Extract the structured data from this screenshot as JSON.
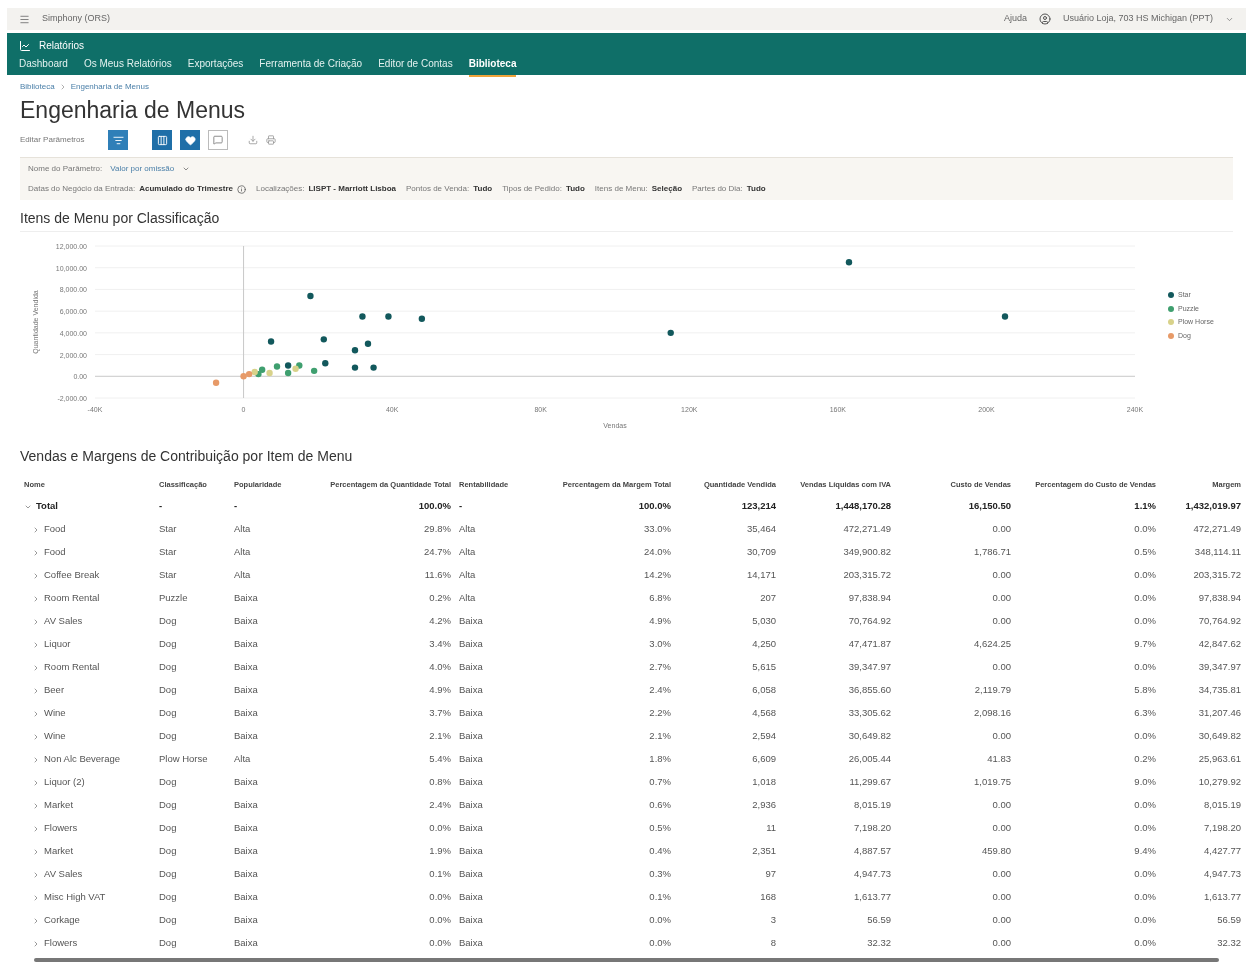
{
  "top_bar": {
    "app_name": "Simphony (ORS)",
    "help": "Ajuda",
    "user": "Usuário Loja, 703 HS Michigan (PPT)"
  },
  "header": {
    "title": "Relatórios",
    "tabs": [
      {
        "label": "Dashboard",
        "selected": false
      },
      {
        "label": "Os Meus Relatórios",
        "selected": false
      },
      {
        "label": "Exportações",
        "selected": false
      },
      {
        "label": "Ferramenta de Criação",
        "selected": false
      },
      {
        "label": "Editor de Contas",
        "selected": false
      },
      {
        "label": "Biblioteca",
        "selected": true
      }
    ]
  },
  "breadcrumb": [
    "Biblioteca",
    "Engenharia de Menus"
  ],
  "page_title": "Engenharia de Menus",
  "toolbar": {
    "label": "Editar Parâmetros"
  },
  "parameters": {
    "label": "Nome do Parâmetro:",
    "value": "Valor por omissão"
  },
  "filters": [
    {
      "label": "Datas do Negócio da Entrada:",
      "value": "Acumulado do Trimestre",
      "info": true
    },
    {
      "label": "Localizações:",
      "value": "LISPT - Marriott Lisboa"
    },
    {
      "label": "Pontos de Venda:",
      "value": "Tudo"
    },
    {
      "label": "Tipos de Pedido:",
      "value": "Tudo"
    },
    {
      "label": "Itens de Menu:",
      "value": "Seleção"
    },
    {
      "label": "Partes do Dia:",
      "value": "Tudo"
    }
  ],
  "chart_section": {
    "title": "Itens de Menu por Classificação",
    "chart_data": {
      "type": "scatter",
      "grid": true,
      "xlabel": "Vendas",
      "ylabel": "Quantidade Vendida",
      "xlim": [
        -40000,
        240000
      ],
      "ylim": [
        -2000,
        12000
      ],
      "xticks": [
        {
          "value": -40000,
          "label": "-40K"
        },
        {
          "value": 0,
          "label": "0"
        },
        {
          "value": 40000,
          "label": "40K"
        },
        {
          "value": 80000,
          "label": "80K"
        },
        {
          "value": 120000,
          "label": "120K"
        },
        {
          "value": 160000,
          "label": "160K"
        },
        {
          "value": 200000,
          "label": "200K"
        },
        {
          "value": 240000,
          "label": "240K"
        }
      ],
      "yticks": [
        {
          "value": -2000,
          "label": "-2,000.00"
        },
        {
          "value": 0,
          "label": "0.00"
        },
        {
          "value": 2000,
          "label": "2,000.00"
        },
        {
          "value": 4000,
          "label": "4,000.00"
        },
        {
          "value": 6000,
          "label": "6,000.00"
        },
        {
          "value": 8000,
          "label": "8,000.00"
        },
        {
          "value": 10000,
          "label": "10,000.00"
        },
        {
          "value": 12000,
          "label": "12,000.00"
        }
      ],
      "series": [
        {
          "name": "Star",
          "color": "#12585c",
          "x": [
            163000,
            205000,
            115000,
            18000,
            32000,
            39000,
            48000,
            7400,
            21600,
            30000,
            33500,
            30000,
            35000,
            12000,
            22000
          ],
          "values": [
            10500,
            5500,
            4000,
            7400,
            5500,
            5500,
            5300,
            3200,
            3400,
            2400,
            3000,
            800,
            800,
            1000,
            1200
          ]
        },
        {
          "name": "Puzzle",
          "color": "#3f9f6f",
          "x": [
            5000,
            9000,
            12000,
            15000,
            19000,
            4000
          ],
          "values": [
            600,
            900,
            300,
            1000,
            500,
            200
          ]
        },
        {
          "name": "Plow Horse",
          "color": "#d8d28a",
          "x": [
            3000,
            7000,
            14000
          ],
          "values": [
            400,
            300,
            700
          ]
        },
        {
          "name": "Dog",
          "color": "#e79a68",
          "x": [
            0,
            1500,
            -7400
          ],
          "values": [
            0,
            200,
            -600
          ]
        }
      ]
    }
  },
  "table": {
    "title": "Vendas e Margens de Contribuição por Item de Menu",
    "columns": [
      {
        "label": "Nome",
        "kind": "text"
      },
      {
        "label": "Classificação",
        "kind": "text"
      },
      {
        "label": "Popularidade",
        "kind": "text"
      },
      {
        "label": "Percentagem da Quantidade Total",
        "kind": "number"
      },
      {
        "label": "Rentabilidade",
        "kind": "text"
      },
      {
        "label": "Percentagem da Margem Total",
        "kind": "number"
      },
      {
        "label": "Quantidade Vendida",
        "kind": "number"
      },
      {
        "label": "Vendas Líquidas com IVA",
        "kind": "number"
      },
      {
        "label": "Custo de Vendas",
        "kind": "number"
      },
      {
        "label": "Percentagem do Custo de Vendas",
        "kind": "number"
      },
      {
        "label": "Margem",
        "kind": "number"
      }
    ],
    "rows": [
      {
        "kind": "total",
        "expanded": true,
        "cells": [
          "Total",
          "-",
          "-",
          "100.0%",
          "-",
          "100.0%",
          "123,214",
          "1,448,170.28",
          "16,150.50",
          "1.1%",
          "1,432,019.97"
        ]
      },
      {
        "kind": "item",
        "expanded": false,
        "cells": [
          "Food",
          "Star",
          "Alta",
          "29.8%",
          "Alta",
          "33.0%",
          "35,464",
          "472,271.49",
          "0.00",
          "0.0%",
          "472,271.49"
        ]
      },
      {
        "kind": "item",
        "expanded": false,
        "cells": [
          "Food",
          "Star",
          "Alta",
          "24.7%",
          "Alta",
          "24.0%",
          "30,709",
          "349,900.82",
          "1,786.71",
          "0.5%",
          "348,114.11"
        ]
      },
      {
        "kind": "item",
        "expanded": false,
        "cells": [
          "Coffee Break",
          "Star",
          "Alta",
          "11.6%",
          "Alta",
          "14.2%",
          "14,171",
          "203,315.72",
          "0.00",
          "0.0%",
          "203,315.72"
        ]
      },
      {
        "kind": "item",
        "expanded": false,
        "cells": [
          "Room Rental",
          "Puzzle",
          "Baixa",
          "0.2%",
          "Alta",
          "6.8%",
          "207",
          "97,838.94",
          "0.00",
          "0.0%",
          "97,838.94"
        ]
      },
      {
        "kind": "item",
        "expanded": false,
        "cells": [
          "AV Sales",
          "Dog",
          "Baixa",
          "4.2%",
          "Baixa",
          "4.9%",
          "5,030",
          "70,764.92",
          "0.00",
          "0.0%",
          "70,764.92"
        ]
      },
      {
        "kind": "item",
        "expanded": false,
        "cells": [
          "Liquor",
          "Dog",
          "Baixa",
          "3.4%",
          "Baixa",
          "3.0%",
          "4,250",
          "47,471.87",
          "4,624.25",
          "9.7%",
          "42,847.62"
        ]
      },
      {
        "kind": "item",
        "expanded": false,
        "cells": [
          "Room Rental",
          "Dog",
          "Baixa",
          "4.0%",
          "Baixa",
          "2.7%",
          "5,615",
          "39,347.97",
          "0.00",
          "0.0%",
          "39,347.97"
        ]
      },
      {
        "kind": "item",
        "expanded": false,
        "cells": [
          "Beer",
          "Dog",
          "Baixa",
          "4.9%",
          "Baixa",
          "2.4%",
          "6,058",
          "36,855.60",
          "2,119.79",
          "5.8%",
          "34,735.81"
        ]
      },
      {
        "kind": "item",
        "expanded": false,
        "cells": [
          "Wine",
          "Dog",
          "Baixa",
          "3.7%",
          "Baixa",
          "2.2%",
          "4,568",
          "33,305.62",
          "2,098.16",
          "6.3%",
          "31,207.46"
        ]
      },
      {
        "kind": "item",
        "expanded": false,
        "cells": [
          "Wine",
          "Dog",
          "Baixa",
          "2.1%",
          "Baixa",
          "2.1%",
          "2,594",
          "30,649.82",
          "0.00",
          "0.0%",
          "30,649.82"
        ]
      },
      {
        "kind": "item",
        "expanded": false,
        "cells": [
          "Non Alc Beverage",
          "Plow Horse",
          "Alta",
          "5.4%",
          "Baixa",
          "1.8%",
          "6,609",
          "26,005.44",
          "41.83",
          "0.2%",
          "25,963.61"
        ]
      },
      {
        "kind": "item",
        "expanded": false,
        "cells": [
          "Liquor (2)",
          "Dog",
          "Baixa",
          "0.8%",
          "Baixa",
          "0.7%",
          "1,018",
          "11,299.67",
          "1,019.75",
          "9.0%",
          "10,279.92"
        ]
      },
      {
        "kind": "item",
        "expanded": false,
        "cells": [
          "Market",
          "Dog",
          "Baixa",
          "2.4%",
          "Baixa",
          "0.6%",
          "2,936",
          "8,015.19",
          "0.00",
          "0.0%",
          "8,015.19"
        ]
      },
      {
        "kind": "item",
        "expanded": false,
        "cells": [
          "Flowers",
          "Dog",
          "Baixa",
          "0.0%",
          "Baixa",
          "0.5%",
          "11",
          "7,198.20",
          "0.00",
          "0.0%",
          "7,198.20"
        ]
      },
      {
        "kind": "item",
        "expanded": false,
        "cells": [
          "Market",
          "Dog",
          "Baixa",
          "1.9%",
          "Baixa",
          "0.4%",
          "2,351",
          "4,887.57",
          "459.80",
          "9.4%",
          "4,427.77"
        ]
      },
      {
        "kind": "item",
        "expanded": false,
        "cells": [
          "AV Sales",
          "Dog",
          "Baixa",
          "0.1%",
          "Baixa",
          "0.3%",
          "97",
          "4,947.73",
          "0.00",
          "0.0%",
          "4,947.73"
        ]
      },
      {
        "kind": "item",
        "expanded": false,
        "cells": [
          "Misc High VAT",
          "Dog",
          "Baixa",
          "0.0%",
          "Baixa",
          "0.1%",
          "168",
          "1,613.77",
          "0.00",
          "0.0%",
          "1,613.77"
        ]
      },
      {
        "kind": "item",
        "expanded": false,
        "cells": [
          "Corkage",
          "Dog",
          "Baixa",
          "0.0%",
          "Baixa",
          "0.0%",
          "3",
          "56.59",
          "0.00",
          "0.0%",
          "56.59"
        ]
      },
      {
        "kind": "item",
        "expanded": false,
        "cells": [
          "Flowers",
          "Dog",
          "Baixa",
          "0.0%",
          "Baixa",
          "0.0%",
          "8",
          "32.32",
          "0.00",
          "0.0%",
          "32.32"
        ]
      }
    ]
  }
}
